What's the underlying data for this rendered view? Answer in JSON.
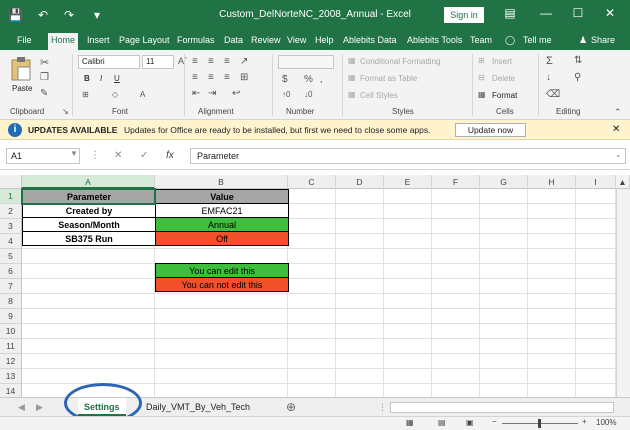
{
  "window": {
    "title": "Custom_DelNorteNC_2008_Annual  -  Excel",
    "sign_in": "Sign in",
    "minimize": "—",
    "restore": "☐",
    "close": "✕"
  },
  "tabs": [
    "File",
    "Home",
    "Insert",
    "Page Layout",
    "Formulas",
    "Data",
    "Review",
    "View",
    "Help",
    "Ablebits Data",
    "Ablebits Tools",
    "Team",
    "Tell me",
    "Share"
  ],
  "ribbon": {
    "clipboard": {
      "label": "Clipboard",
      "paste": "Paste"
    },
    "font": {
      "label": "Font",
      "name": "Calibri",
      "size": "11",
      "bold": "B",
      "italic": "I",
      "underline": "U"
    },
    "alignment": {
      "label": "Alignment"
    },
    "number": {
      "label": "Number",
      "currency": "$",
      "percent": "%"
    },
    "styles": {
      "label": "Styles",
      "conditional": "Conditional Formatting",
      "format_table": "Format as Table",
      "cell_styles": "Cell Styles"
    },
    "cells": {
      "label": "Cells",
      "insert": "Insert",
      "delete": "Delete",
      "format": "Format"
    },
    "editing": {
      "label": "Editing"
    }
  },
  "update_bar": {
    "title": "UPDATES AVAILABLE",
    "message": "Updates for Office are ready to be installed, but first we need to close some apps.",
    "button": "Update now"
  },
  "formula_bar": {
    "name_box": "A1",
    "fx": "fx",
    "content": "Parameter"
  },
  "columns": [
    "A",
    "B",
    "C",
    "D",
    "E",
    "F",
    "G",
    "H",
    "I"
  ],
  "rows": [
    "1",
    "2",
    "3",
    "4",
    "5",
    "6",
    "7",
    "8",
    "9",
    "10",
    "11",
    "12",
    "13",
    "14"
  ],
  "cells": {
    "a1": "Parameter",
    "b1": "Value",
    "a2": "Created by",
    "b2": "EMFAC21",
    "a3": "Season/Month",
    "b3": "Annual",
    "a4": "SB375 Run",
    "b4": "Off",
    "b6": "You can edit this",
    "b7": "You can not edit this"
  },
  "colors": {
    "excel_green": "#217346",
    "header_fill": "#a6a6a6",
    "green_fill": "#3dbe3d",
    "red_fill": "#f0502a",
    "annotation": "#2e64b4"
  },
  "sheets": [
    "Settings",
    "Daily_VMT_By_Veh_Tech"
  ],
  "status": {
    "zoom": "100%"
  }
}
